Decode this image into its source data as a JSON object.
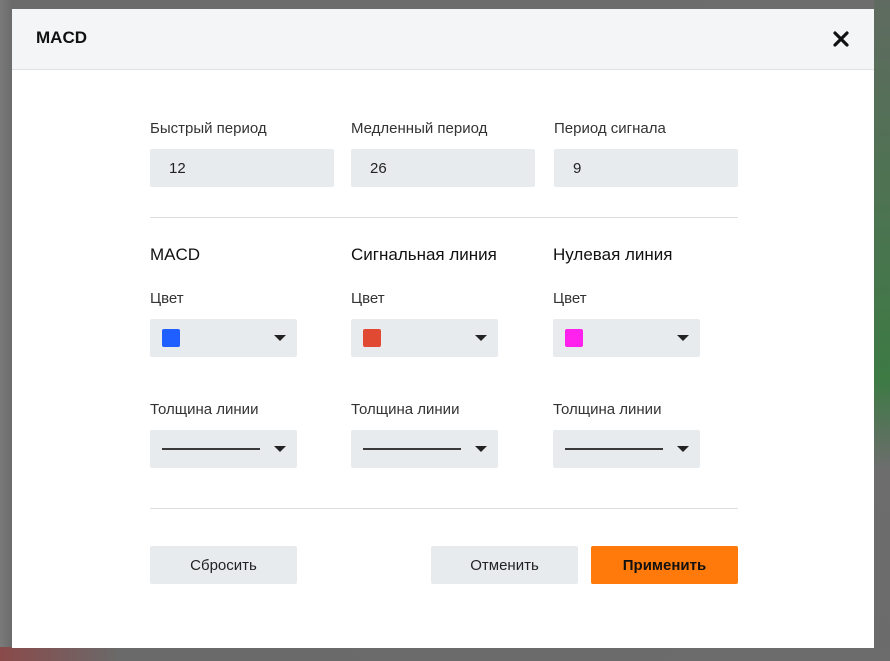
{
  "dialog": {
    "title": "MACD",
    "close_icon": "close-x-icon"
  },
  "periods": {
    "fast": {
      "label": "Быстрый период",
      "value": "12"
    },
    "slow": {
      "label": "Медленный период",
      "value": "26"
    },
    "signal": {
      "label": "Период сигнала",
      "value": "9"
    }
  },
  "lines": [
    {
      "title": "MACD",
      "color_label": "Цвет",
      "color": "#1f5eff",
      "width_label": "Толщина линии"
    },
    {
      "title": "Сигнальная линия",
      "color_label": "Цвет",
      "color": "#e04a33",
      "width_label": "Толщина линии"
    },
    {
      "title": "Нулевая линия",
      "color_label": "Цвет",
      "color": "#ff22ee",
      "width_label": "Толщина линии"
    }
  ],
  "buttons": {
    "reset": "Сбросить",
    "cancel": "Отменить",
    "apply": "Применить"
  },
  "colors": {
    "accent": "#ff7a0a",
    "input_bg": "#e8ebee"
  }
}
